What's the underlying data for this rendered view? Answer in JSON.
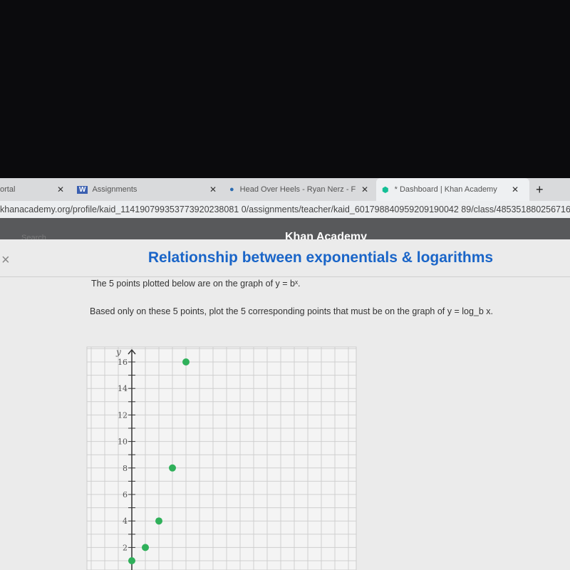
{
  "browser": {
    "tabs": [
      {
        "label": "ortal",
        "icon": "portal-icon"
      },
      {
        "label": "Assignments",
        "icon": "w-logo-icon"
      },
      {
        "label": "Head Over Heels - Ryan Nerz - F",
        "icon": "book-icon"
      },
      {
        "label": "* Dashboard | Khan Academy",
        "icon": "khan-academy-icon",
        "active": true
      }
    ],
    "new_tab": "+",
    "url": "khanacademy.org/profile/kaid_114190799353773920238081 0/assignments/teacher/kaid_601798840959209190042 89/class/4853518802567168"
  },
  "header": {
    "site": "Khan Academy",
    "search": "Search"
  },
  "exercise": {
    "title": "Relationship between exponentials & logarithms",
    "close": "×",
    "line1": "The 5 points plotted below are on the graph of y = bˣ.",
    "line2": "Based only on these 5 points, plot the 5 corresponding points that must be on the graph of y = log_b x."
  },
  "chart_data": {
    "type": "scatter",
    "ylabel": "y",
    "yticks": [
      2,
      4,
      6,
      8,
      10,
      12,
      14,
      16
    ],
    "ytick_labels": [
      "2",
      "4",
      "6",
      "8",
      "10",
      "12",
      "14",
      "16"
    ],
    "grid": true,
    "point_color": "#2fb05a",
    "points": [
      {
        "x": 0,
        "y": 1
      },
      {
        "x": 1,
        "y": 2
      },
      {
        "x": 2,
        "y": 4
      },
      {
        "x": 3,
        "y": 8
      },
      {
        "x": 4,
        "y": 16
      }
    ]
  }
}
